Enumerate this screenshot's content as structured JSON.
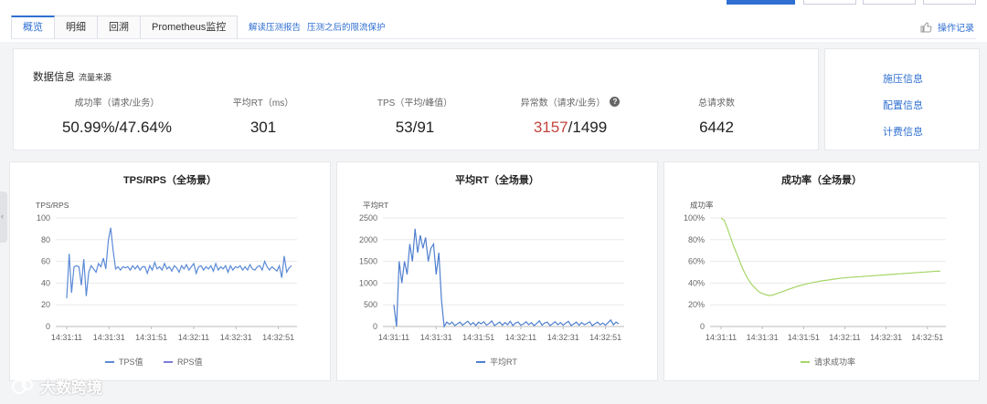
{
  "tabs": [
    {
      "label": "概览",
      "active": true
    },
    {
      "label": "明细",
      "active": false
    },
    {
      "label": "回溯",
      "active": false
    },
    {
      "label": "Prometheus监控",
      "active": false
    }
  ],
  "links": {
    "report": "解读压测报告",
    "rate_limit": "压测之后的限流保护",
    "operation_log": "操作记录"
  },
  "summary": {
    "title": "数据信息",
    "subtitle": "流量来源",
    "metrics": [
      {
        "label": "成功率（请求/业务）",
        "value": "50.99%/47.64%"
      },
      {
        "label": "平均RT（ms）",
        "value": "301"
      },
      {
        "label": "TPS（平均/峰值）",
        "value": "53/91"
      },
      {
        "label": "异常数（请求/业务）",
        "value_error": "3157",
        "value_rest": "/1499",
        "help": "?"
      },
      {
        "label": "总请求数",
        "value": "6442"
      }
    ]
  },
  "side_links": [
    "施压信息",
    "配置信息",
    "计费信息"
  ],
  "colors": {
    "accent": "#2f6fd1",
    "error": "#c4443d",
    "tps": "#5b8ad6",
    "rps": "#7b7fd8",
    "rt": "#4f7fcf",
    "success": "#a6d568"
  },
  "watermark": "大数跨境",
  "chart_data": [
    {
      "type": "line",
      "title": "TPS/RPS（全场景）",
      "ylabel": "TPS/RPS",
      "ylim": [
        0,
        100
      ],
      "yticks": [
        "0",
        "20",
        "40",
        "60",
        "80",
        "100"
      ],
      "xticks": [
        "14:31:11",
        "14:31:31",
        "14:31:51",
        "14:32:11",
        "14:32:31",
        "14:32:51"
      ],
      "series": [
        {
          "name": "TPS值",
          "values": [
            26,
            67,
            31,
            55,
            56,
            55,
            38,
            62,
            28,
            50,
            56,
            53,
            50,
            58,
            55,
            63,
            53,
            79,
            91,
            70,
            53,
            55,
            52,
            55,
            54,
            55,
            52,
            56,
            53,
            56,
            52,
            55,
            55,
            49,
            56,
            52,
            59,
            53,
            55,
            52,
            58,
            53,
            55,
            51,
            56,
            54,
            50,
            56,
            53,
            57,
            52,
            55,
            58,
            49,
            55,
            56,
            52,
            55,
            53,
            56,
            51,
            58,
            52,
            55,
            53,
            56,
            50,
            56,
            52,
            55,
            54,
            56,
            52,
            55,
            52,
            57,
            53,
            52,
            55,
            56,
            52,
            60,
            55,
            52,
            55,
            53,
            51,
            56,
            45,
            65,
            50,
            54,
            56
          ]
        },
        {
          "name": "RPS值",
          "values": []
        }
      ]
    },
    {
      "type": "line",
      "title": "平均RT（全场景）",
      "ylabel": "平均RT",
      "ylim": [
        0,
        2500
      ],
      "yticks": [
        "0",
        "500",
        "1000",
        "1500",
        "2000",
        "2500"
      ],
      "xticks": [
        "14:31:11",
        "14:31:31",
        "14:31:51",
        "14:32:11",
        "14:32:31",
        "14:32:51"
      ],
      "series": [
        {
          "name": "平均RT",
          "values": [
            500,
            0,
            1500,
            1000,
            1500,
            1200,
            1900,
            1500,
            2250,
            1700,
            2100,
            1800,
            2050,
            1500,
            1800,
            1900,
            1200,
            1700,
            600,
            0,
            100,
            50,
            100,
            20,
            60,
            100,
            30,
            80,
            120,
            40,
            90,
            20,
            100,
            60,
            110,
            30,
            70,
            130,
            20,
            60,
            100,
            30,
            90,
            40,
            120,
            20,
            80,
            100,
            30,
            60,
            110,
            40,
            90,
            20,
            70,
            130,
            30,
            80,
            100,
            20,
            60,
            110,
            40,
            90,
            30,
            80,
            120,
            20,
            60,
            100,
            30,
            90,
            40,
            70,
            110,
            20,
            60,
            100,
            40,
            80,
            30,
            90,
            150,
            40,
            100,
            60
          ]
        }
      ]
    },
    {
      "type": "line",
      "title": "成功率（全场景）",
      "ylabel": "成功率",
      "ylim": [
        0,
        100
      ],
      "yticks": [
        "0",
        "20%",
        "40%",
        "60%",
        "80%",
        "100%"
      ],
      "xticks": [
        "14:31:11",
        "14:31:31",
        "14:31:51",
        "14:32:11",
        "14:32:31",
        "14:32:51"
      ],
      "series": [
        {
          "name": "请求成功率",
          "values": [
            100,
            98,
            91,
            83,
            75,
            68,
            61,
            54,
            48,
            43,
            39,
            36,
            33,
            31,
            30,
            29,
            28.5,
            29,
            30,
            31,
            32,
            33,
            34,
            35,
            36,
            37,
            37.8,
            38.5,
            39.2,
            39.8,
            40.4,
            41,
            41.5,
            42,
            42.4,
            42.8,
            43.2,
            43.6,
            44,
            44.4,
            44.7,
            45,
            45.2,
            45.4,
            45.6,
            45.8,
            46,
            46.2,
            46.4,
            46.6,
            46.8,
            47,
            47.2,
            47.4,
            47.6,
            47.8,
            48,
            48.2,
            48.4,
            48.6,
            48.8,
            49,
            49.2,
            49.4,
            49.6,
            49.8,
            50,
            50.2,
            50.4,
            50.6,
            50.8,
            50.9,
            51
          ]
        }
      ]
    }
  ]
}
